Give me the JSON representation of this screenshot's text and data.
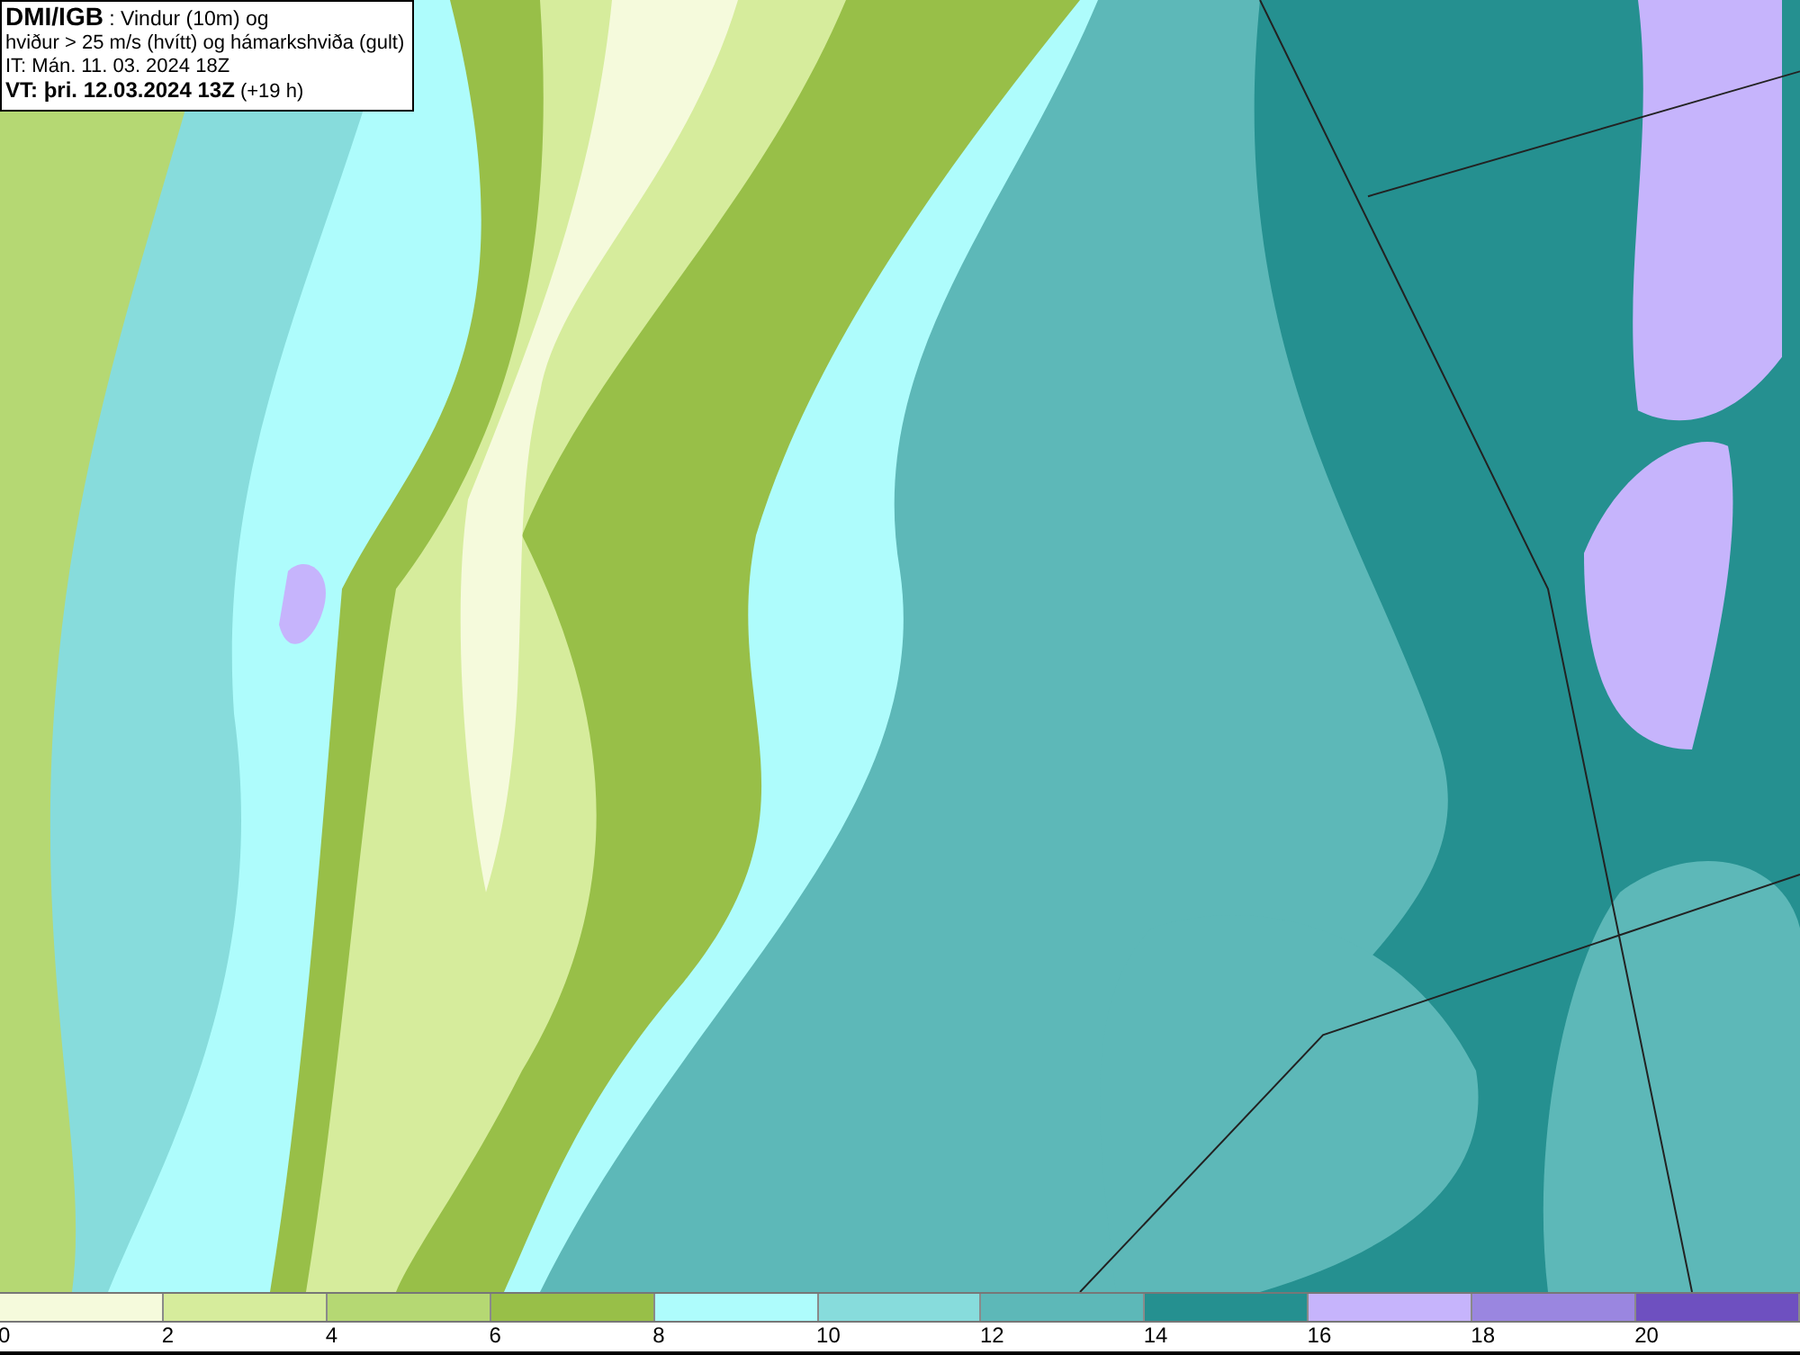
{
  "info_box": {
    "lines": [
      "**DMI/IGB** : Vindur (10m) og",
      "hviður > 25 m/s (hvítt) og hámarkshviða (gult)",
      "IT: Mán. 11. 03. 2024 18Z",
      "**VT: þri. 12.03.2024 13Z** (+19 h)"
    ]
  },
  "legend": {
    "swatches": [
      {
        "color": "#f5fadc",
        "label": "0"
      },
      {
        "color": "#d6ec9c",
        "label": "2"
      },
      {
        "color": "#b5d873",
        "label": "4"
      },
      {
        "color": "#98bf48",
        "label": "6"
      },
      {
        "color": "#aefcfc",
        "label": "8"
      },
      {
        "color": "#87dcdc",
        "label": "10"
      },
      {
        "color": "#5db8b8",
        "label": "12"
      },
      {
        "color": "#259090",
        "label": "14"
      },
      {
        "color": "#c6b4fc",
        "label": "16"
      },
      {
        "color": "#9a86e0",
        "label": "18"
      },
      {
        "color": "#6e50c0",
        "label": "20"
      }
    ]
  }
}
